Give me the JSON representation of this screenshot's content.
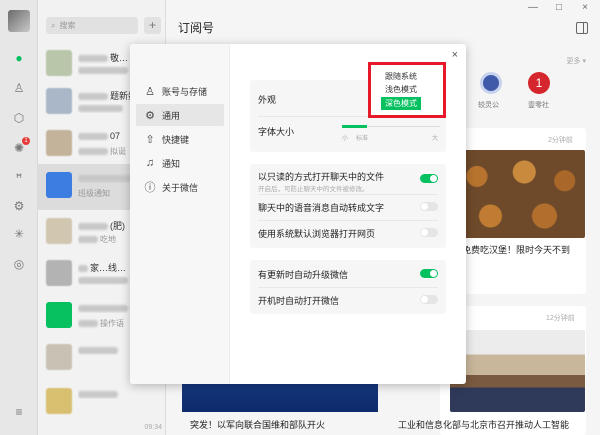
{
  "sidebar": {
    "badge": "1",
    "icons": [
      "chat-icon",
      "contacts-icon",
      "favorites-icon",
      "moments-icon",
      "channels-icon",
      "settings-gear-icon",
      "mini-programs-icon",
      "discover-icon",
      "menu-icon"
    ]
  },
  "chatlist": {
    "search_placeholder": "搜索",
    "plus": "+",
    "items": [
      {
        "name": "敬…",
        "preview": "",
        "time": ""
      },
      {
        "name": "题新数",
        "preview": "",
        "time": ""
      },
      {
        "name": "07",
        "preview": "拟诞",
        "time": ""
      },
      {
        "name": "",
        "preview": "班级通知",
        "time": ""
      },
      {
        "name": "(肥)",
        "preview": "吃地",
        "time": ""
      },
      {
        "name": "家…线…",
        "preview": "",
        "time": ""
      },
      {
        "name": "",
        "preview": "操作语",
        "time": ""
      },
      {
        "name": "",
        "preview": "",
        "time": ""
      },
      {
        "name": "",
        "preview": "",
        "time": "09:34"
      }
    ]
  },
  "main": {
    "title": "订阅号",
    "more": "更多",
    "accounts": [
      {
        "label": "较灵公",
        "color": "#3f5aa9"
      },
      {
        "label": "壹零社",
        "color": "#d6262d"
      }
    ],
    "cards": [
      {
        "time": "2分钟前",
        "headline": "免费吃汉堡！限时今天不到"
      },
      {
        "time": "12分钟前",
        "headline": "工业和信息化部与北京市召开推动人工智能"
      },
      {
        "headline": "突发！以军向联合国维和部队开火"
      }
    ]
  },
  "settings": {
    "close": "×",
    "nav": [
      {
        "label": "账号与存储",
        "icon": "user-icon"
      },
      {
        "label": "通用",
        "icon": "gear-icon"
      },
      {
        "label": "快捷键",
        "icon": "shortcut-icon"
      },
      {
        "label": "通知",
        "icon": "bell-icon"
      },
      {
        "label": "关于微信",
        "icon": "info-icon"
      }
    ],
    "appearance_label": "外观",
    "theme_options": [
      "跟随系统",
      "浅色模式",
      "深色模式"
    ],
    "theme_selected": "深色模式",
    "font_size_label": "字体大小",
    "font_size_marks": [
      "小",
      "标准",
      "大"
    ],
    "font_size_level": 0.25,
    "options_group1": [
      {
        "label": "以只读的方式打开聊天中的文件",
        "sub": "开启后，可防止聊天中的文件被修改。",
        "on": true
      },
      {
        "label": "聊天中的语音消息自动转成文字",
        "sub": "",
        "on": false
      },
      {
        "label": "使用系统默认浏览器打开网页",
        "sub": "",
        "on": false
      }
    ],
    "options_group2": [
      {
        "label": "有更新时自动升级微信",
        "on": true
      },
      {
        "label": "开机时自动打开微信",
        "on": false
      }
    ],
    "accent_color": "#07c160",
    "highlight_color": "#e5192a"
  },
  "window_controls": [
    "—",
    "□",
    "×"
  ]
}
